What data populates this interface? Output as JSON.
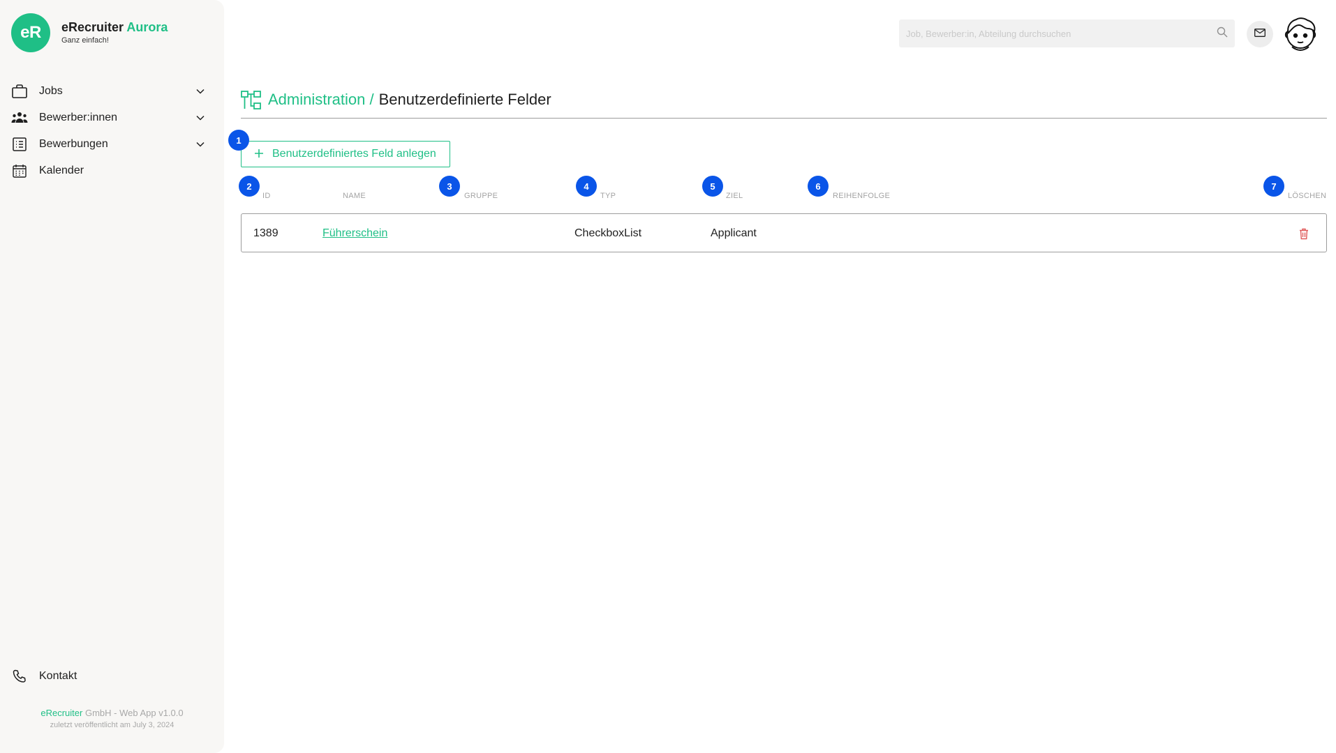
{
  "brand": {
    "logo_text": "eR",
    "name": "eRecruiter",
    "name_accent": "Aurora",
    "tagline": "Ganz einfach!"
  },
  "sidebar": {
    "items": [
      {
        "label": "Jobs",
        "icon": "briefcase-icon",
        "expandable": true
      },
      {
        "label": "Bewerber:innen",
        "icon": "people-icon",
        "expandable": true
      },
      {
        "label": "Bewerbungen",
        "icon": "list-document-icon",
        "expandable": true
      },
      {
        "label": "Kalender",
        "icon": "calendar-icon",
        "expandable": false
      }
    ],
    "contact_label": "Kontakt",
    "footer": {
      "company": "eRecruiter",
      "version": " GmbH - Web App v1.0.0",
      "published": "zuletzt veröffentlicht am July 3, 2024"
    }
  },
  "header": {
    "search_placeholder": "Job, Bewerber:in, Abteilung durchsuchen"
  },
  "page": {
    "breadcrumb_parent": "Administration /",
    "title": "Benutzerdefinierte Felder",
    "add_button_label": "Benutzerdefiniertes Feld anlegen"
  },
  "table": {
    "columns": [
      "ID",
      "NAME",
      "GRUPPE",
      "TYP",
      "ZIEL",
      "REIHENFOLGE",
      "LÖSCHEN"
    ],
    "rows": [
      {
        "id": "1389",
        "name": "Führerschein",
        "gruppe": "",
        "typ": "CheckboxList",
        "ziel": "Applicant",
        "reihenfolge": ""
      }
    ]
  },
  "badges": [
    "1",
    "2",
    "3",
    "4",
    "5",
    "6",
    "7"
  ],
  "colors": {
    "accent": "#1fbf86",
    "badge": "#0a55e8",
    "delete": "#e05a5a",
    "sidebar_bg": "#f8f7f5"
  }
}
